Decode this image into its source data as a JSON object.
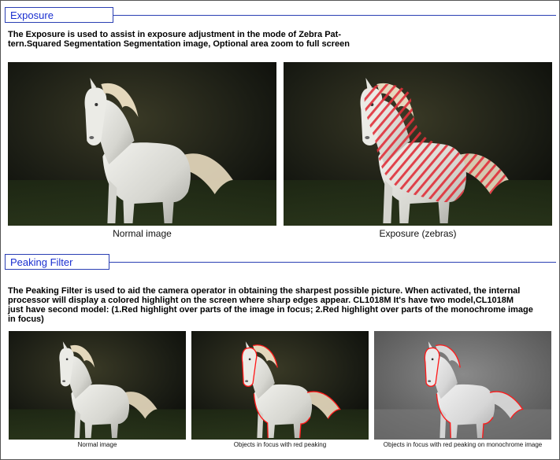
{
  "exposure": {
    "title": "Exposure",
    "description": "The Exposure is used to assist in exposure adjustment in the mode of Zebra Pat-\ntern.Squared Segmentation Segmentation image, Optional area zoom to full screen",
    "images": [
      {
        "caption": "Normal image",
        "variant": "normal"
      },
      {
        "caption": "Exposure (zebras)",
        "variant": "zebra"
      }
    ]
  },
  "peaking": {
    "title": "Peaking Filter",
    "description": "The Peaking Filter is used to aid the camera operator in obtaining the sharpest possible picture. When activated, the internal\nprocessor will display a colored highlight on the screen where sharp edges appear.  CL1018M  It's have two model,CL1018M\njust have second model: (1.Red highlight over parts of the image in focus; 2.Red highlight over parts of the monochrome image\nin focus)",
    "images": [
      {
        "caption": "Normal image",
        "variant": "normal"
      },
      {
        "caption": "Objects in focus with red peaking",
        "variant": "peaking"
      },
      {
        "caption": "Objects in focus with red peaking on monochrome image",
        "variant": "mono-peaking"
      }
    ]
  },
  "colors": {
    "header_blue": "#2a3fb3",
    "zebra_red": "#e0303a",
    "peaking_red": "#ff1a1a"
  }
}
